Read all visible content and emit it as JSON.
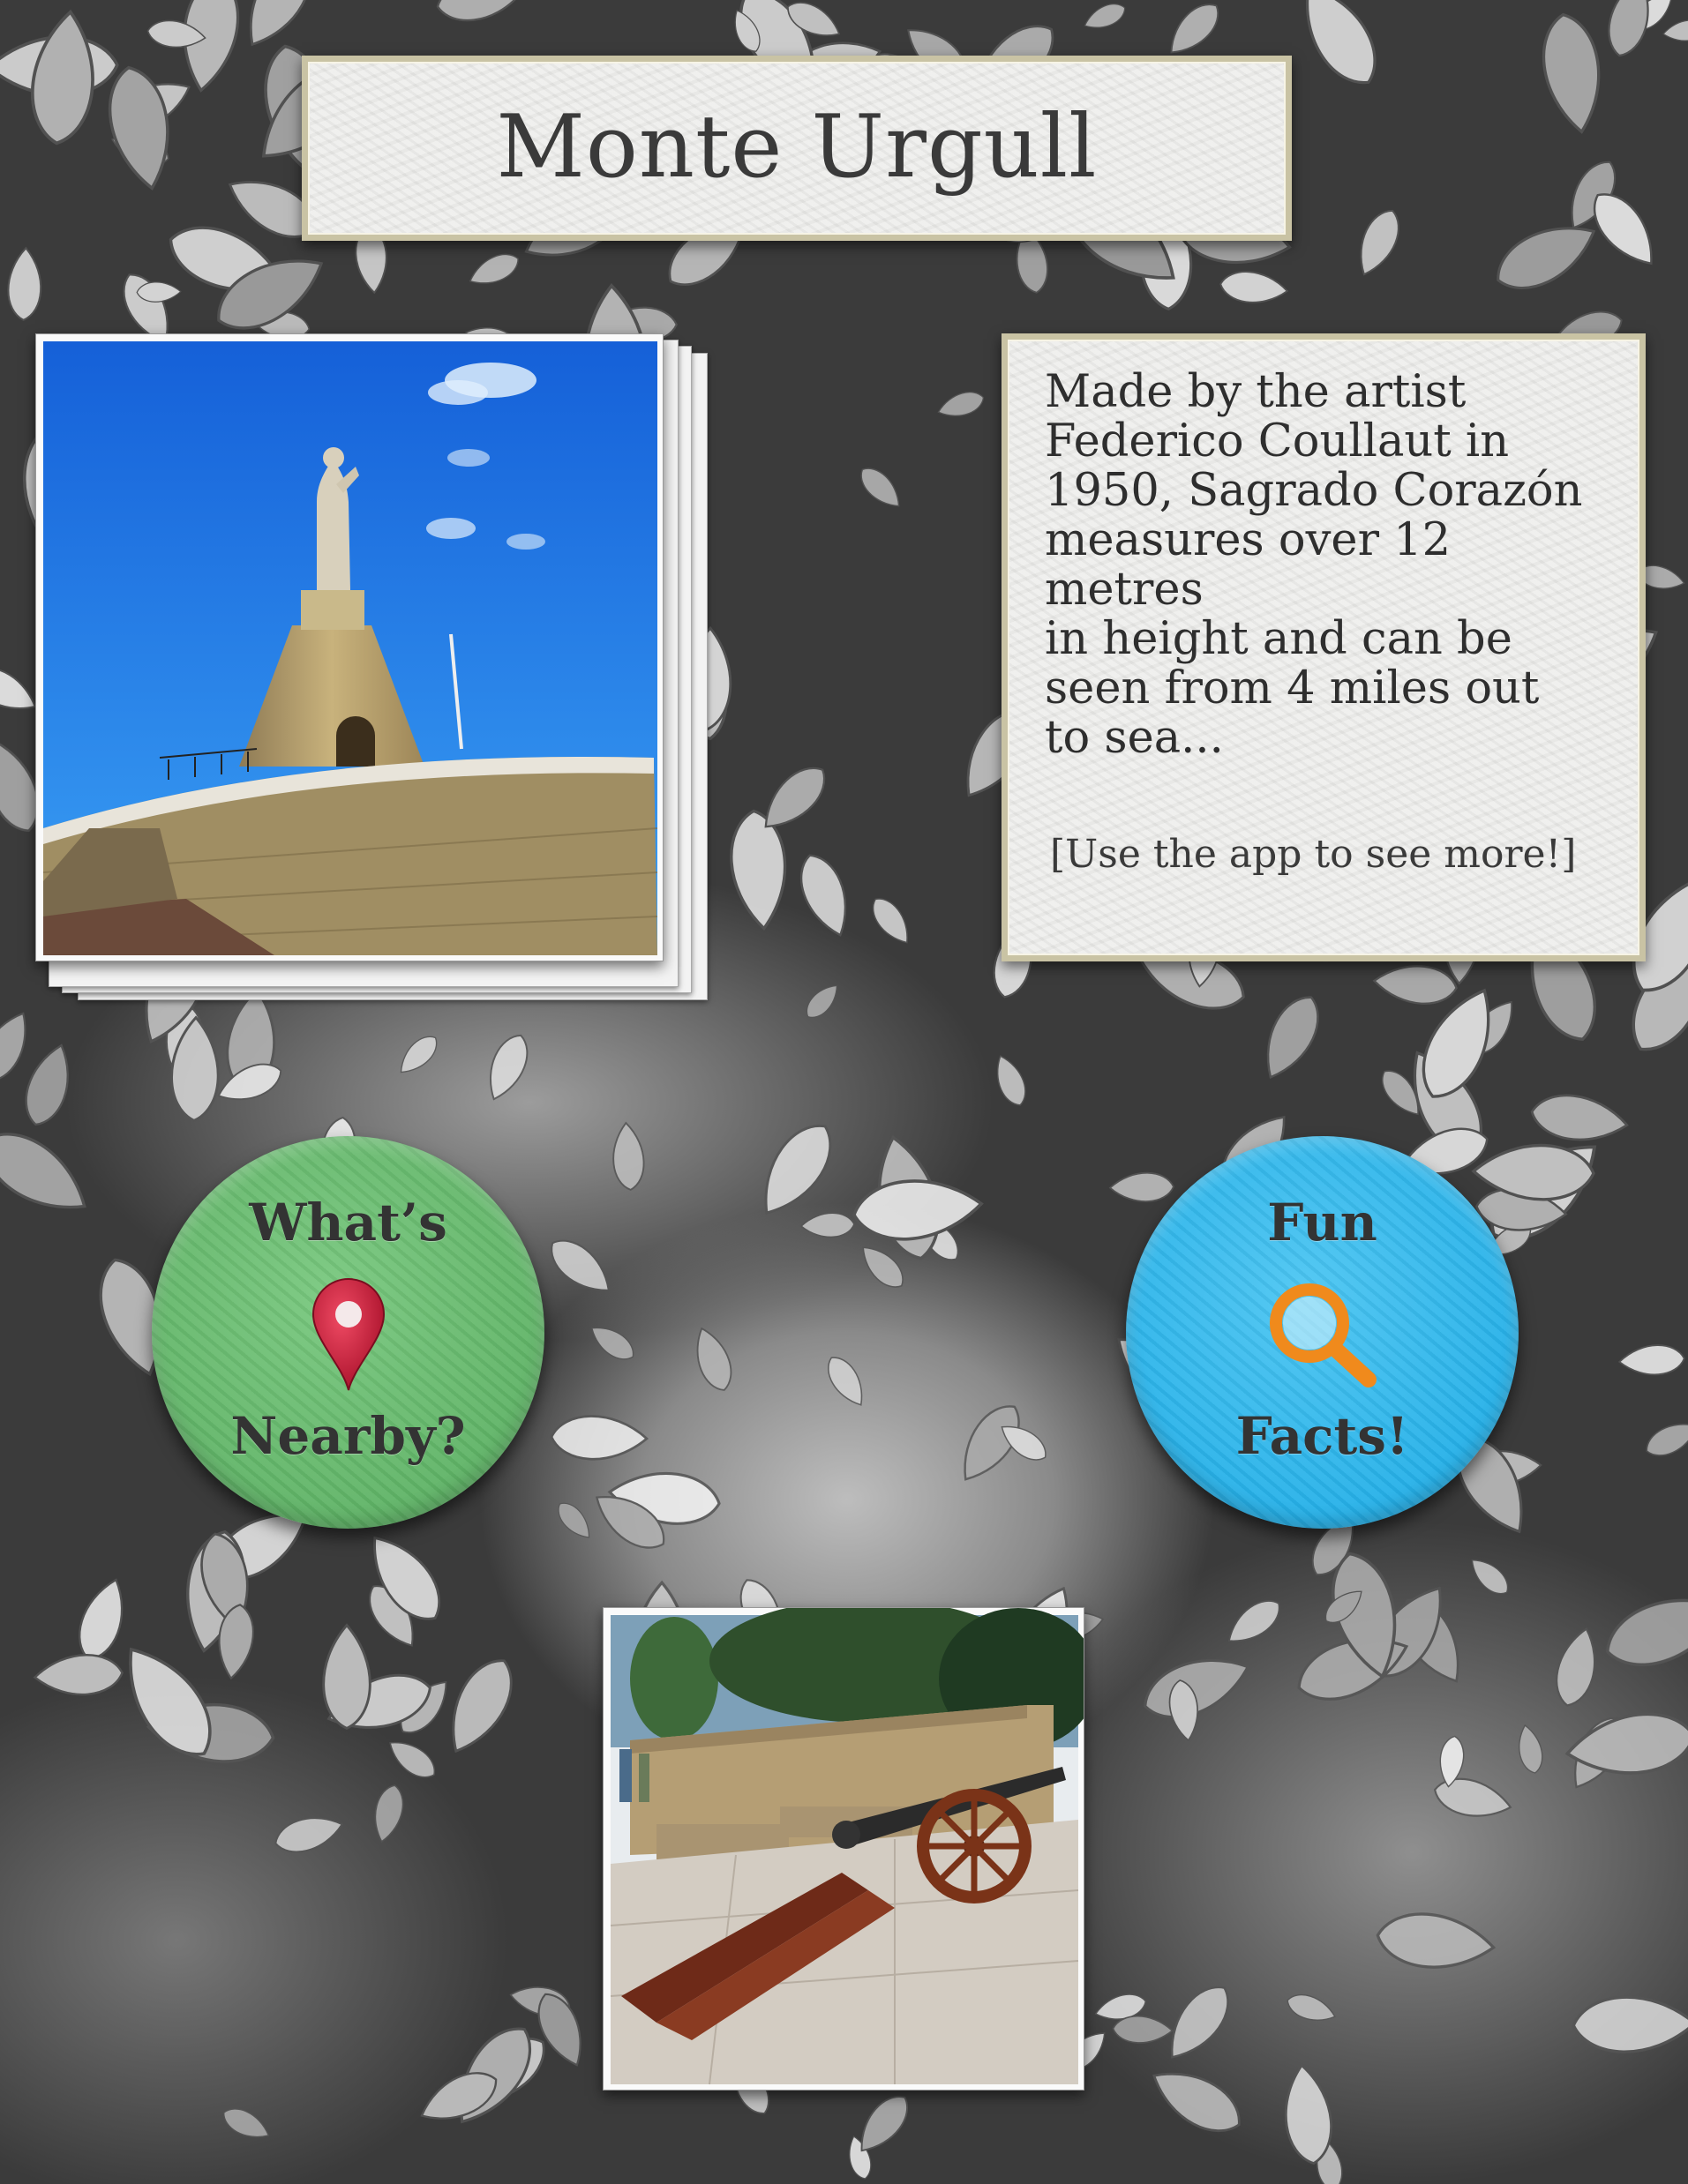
{
  "title": "Monte Urgull",
  "info_panel": {
    "text": "Made by the artist\nFederico Coullaut in\n1950, Sagrado Corazón\nmeasures over 12 metres\nin height and can be\nseen from 4 miles out\nto sea...",
    "call_to_action": "[Use the app to see more!]"
  },
  "buttons": {
    "nearby": {
      "line1": "What’s",
      "line2": "Nearby?",
      "icon": "map-pin-icon",
      "color": "#5fb366"
    },
    "facts": {
      "line1": "Fun",
      "line2": "Facts!",
      "icon": "magnifier-icon",
      "color": "#25b0e8"
    }
  },
  "photos": {
    "statue": {
      "subject": "Sagrado Corazón statue on Monte Urgull"
    },
    "cannon": {
      "subject": "Cannon on the castle ramparts"
    }
  },
  "colors": {
    "plaque": "#eeeeec",
    "plaque_border": "#c9c3a4",
    "sky": "#1f7fe0",
    "pin": "#c81e3a",
    "magnifier": "#f08a1c"
  }
}
